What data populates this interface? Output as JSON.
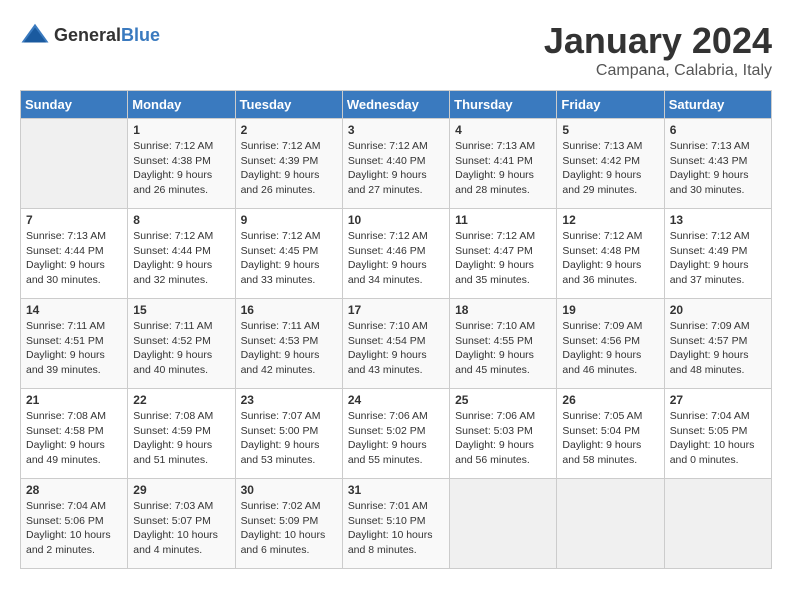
{
  "header": {
    "logo_general": "General",
    "logo_blue": "Blue",
    "title": "January 2024",
    "subtitle": "Campana, Calabria, Italy"
  },
  "days_of_week": [
    "Sunday",
    "Monday",
    "Tuesday",
    "Wednesday",
    "Thursday",
    "Friday",
    "Saturday"
  ],
  "weeks": [
    [
      {
        "day": "",
        "info": ""
      },
      {
        "day": "1",
        "info": "Sunrise: 7:12 AM\nSunset: 4:38 PM\nDaylight: 9 hours\nand 26 minutes."
      },
      {
        "day": "2",
        "info": "Sunrise: 7:12 AM\nSunset: 4:39 PM\nDaylight: 9 hours\nand 26 minutes."
      },
      {
        "day": "3",
        "info": "Sunrise: 7:12 AM\nSunset: 4:40 PM\nDaylight: 9 hours\nand 27 minutes."
      },
      {
        "day": "4",
        "info": "Sunrise: 7:13 AM\nSunset: 4:41 PM\nDaylight: 9 hours\nand 28 minutes."
      },
      {
        "day": "5",
        "info": "Sunrise: 7:13 AM\nSunset: 4:42 PM\nDaylight: 9 hours\nand 29 minutes."
      },
      {
        "day": "6",
        "info": "Sunrise: 7:13 AM\nSunset: 4:43 PM\nDaylight: 9 hours\nand 30 minutes."
      }
    ],
    [
      {
        "day": "7",
        "info": "Sunrise: 7:13 AM\nSunset: 4:44 PM\nDaylight: 9 hours\nand 30 minutes."
      },
      {
        "day": "8",
        "info": "Sunrise: 7:12 AM\nSunset: 4:44 PM\nDaylight: 9 hours\nand 32 minutes."
      },
      {
        "day": "9",
        "info": "Sunrise: 7:12 AM\nSunset: 4:45 PM\nDaylight: 9 hours\nand 33 minutes."
      },
      {
        "day": "10",
        "info": "Sunrise: 7:12 AM\nSunset: 4:46 PM\nDaylight: 9 hours\nand 34 minutes."
      },
      {
        "day": "11",
        "info": "Sunrise: 7:12 AM\nSunset: 4:47 PM\nDaylight: 9 hours\nand 35 minutes."
      },
      {
        "day": "12",
        "info": "Sunrise: 7:12 AM\nSunset: 4:48 PM\nDaylight: 9 hours\nand 36 minutes."
      },
      {
        "day": "13",
        "info": "Sunrise: 7:12 AM\nSunset: 4:49 PM\nDaylight: 9 hours\nand 37 minutes."
      }
    ],
    [
      {
        "day": "14",
        "info": "Sunrise: 7:11 AM\nSunset: 4:51 PM\nDaylight: 9 hours\nand 39 minutes."
      },
      {
        "day": "15",
        "info": "Sunrise: 7:11 AM\nSunset: 4:52 PM\nDaylight: 9 hours\nand 40 minutes."
      },
      {
        "day": "16",
        "info": "Sunrise: 7:11 AM\nSunset: 4:53 PM\nDaylight: 9 hours\nand 42 minutes."
      },
      {
        "day": "17",
        "info": "Sunrise: 7:10 AM\nSunset: 4:54 PM\nDaylight: 9 hours\nand 43 minutes."
      },
      {
        "day": "18",
        "info": "Sunrise: 7:10 AM\nSunset: 4:55 PM\nDaylight: 9 hours\nand 45 minutes."
      },
      {
        "day": "19",
        "info": "Sunrise: 7:09 AM\nSunset: 4:56 PM\nDaylight: 9 hours\nand 46 minutes."
      },
      {
        "day": "20",
        "info": "Sunrise: 7:09 AM\nSunset: 4:57 PM\nDaylight: 9 hours\nand 48 minutes."
      }
    ],
    [
      {
        "day": "21",
        "info": "Sunrise: 7:08 AM\nSunset: 4:58 PM\nDaylight: 9 hours\nand 49 minutes."
      },
      {
        "day": "22",
        "info": "Sunrise: 7:08 AM\nSunset: 4:59 PM\nDaylight: 9 hours\nand 51 minutes."
      },
      {
        "day": "23",
        "info": "Sunrise: 7:07 AM\nSunset: 5:00 PM\nDaylight: 9 hours\nand 53 minutes."
      },
      {
        "day": "24",
        "info": "Sunrise: 7:06 AM\nSunset: 5:02 PM\nDaylight: 9 hours\nand 55 minutes."
      },
      {
        "day": "25",
        "info": "Sunrise: 7:06 AM\nSunset: 5:03 PM\nDaylight: 9 hours\nand 56 minutes."
      },
      {
        "day": "26",
        "info": "Sunrise: 7:05 AM\nSunset: 5:04 PM\nDaylight: 9 hours\nand 58 minutes."
      },
      {
        "day": "27",
        "info": "Sunrise: 7:04 AM\nSunset: 5:05 PM\nDaylight: 10 hours\nand 0 minutes."
      }
    ],
    [
      {
        "day": "28",
        "info": "Sunrise: 7:04 AM\nSunset: 5:06 PM\nDaylight: 10 hours\nand 2 minutes."
      },
      {
        "day": "29",
        "info": "Sunrise: 7:03 AM\nSunset: 5:07 PM\nDaylight: 10 hours\nand 4 minutes."
      },
      {
        "day": "30",
        "info": "Sunrise: 7:02 AM\nSunset: 5:09 PM\nDaylight: 10 hours\nand 6 minutes."
      },
      {
        "day": "31",
        "info": "Sunrise: 7:01 AM\nSunset: 5:10 PM\nDaylight: 10 hours\nand 8 minutes."
      },
      {
        "day": "",
        "info": ""
      },
      {
        "day": "",
        "info": ""
      },
      {
        "day": "",
        "info": ""
      }
    ]
  ]
}
